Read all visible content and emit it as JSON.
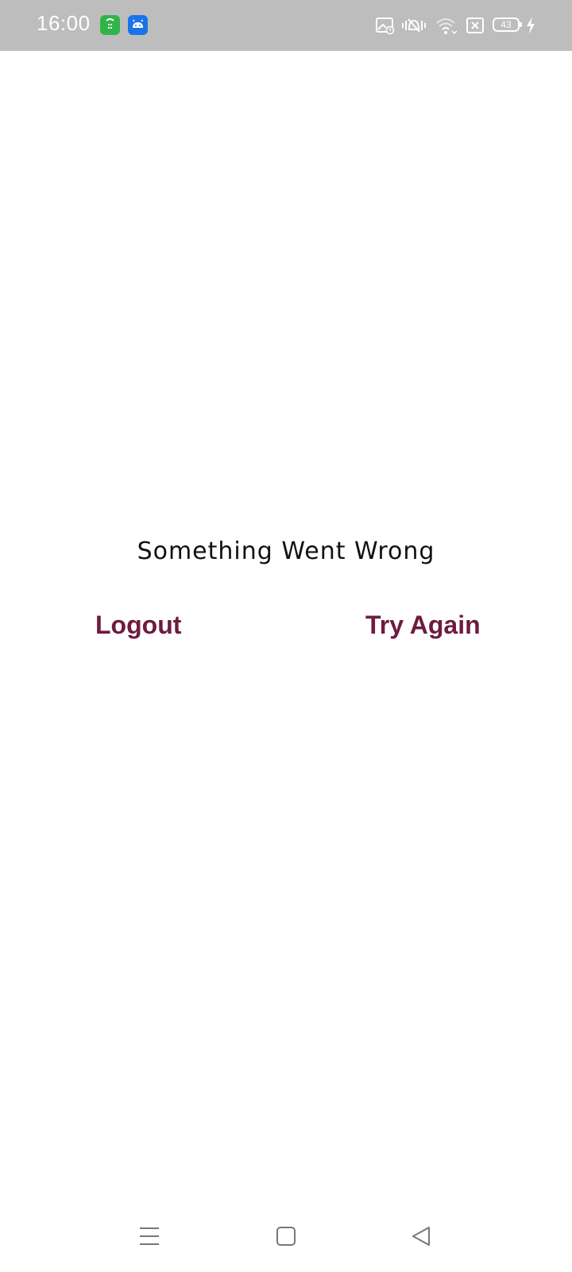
{
  "status_bar": {
    "time": "16:00",
    "battery": "43",
    "background_color": "#bdbdbd",
    "icons": [
      "store-app-icon",
      "android-app-icon",
      "image-icon",
      "vibrate-silent-icon",
      "wifi-icon",
      "sim-off-icon",
      "battery-icon",
      "charging-icon"
    ]
  },
  "main": {
    "message": "Something Went Wrong",
    "logout_label": "Logout",
    "try_again_label": "Try Again",
    "accent_color": "#6e1b3f"
  },
  "nav_bar": {
    "icons": [
      "menu-icon",
      "home-icon",
      "back-icon"
    ]
  }
}
